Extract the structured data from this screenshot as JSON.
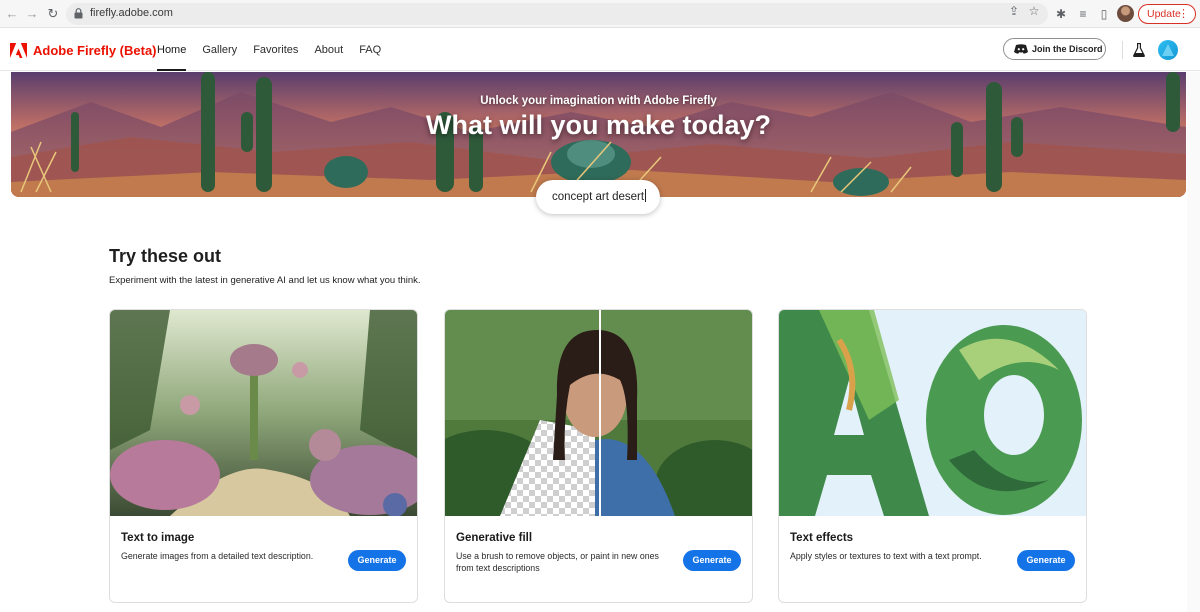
{
  "browser": {
    "url": "firefly.adobe.com",
    "update_label": "Update"
  },
  "header": {
    "brand": "Adobe Firefly (Beta)",
    "tabs": [
      {
        "label": "Home",
        "active": true
      },
      {
        "label": "Gallery",
        "active": false
      },
      {
        "label": "Favorites",
        "active": false
      },
      {
        "label": "About",
        "active": false
      },
      {
        "label": "FAQ",
        "active": false
      }
    ],
    "discord_label": "Join the Discord"
  },
  "hero": {
    "subtitle": "Unlock your imagination with Adobe Firefly",
    "title": "What will you make today?",
    "prompt_value": "concept art desert"
  },
  "section": {
    "title": "Try these out",
    "subtitle": "Experiment with the latest in generative AI and let us know what you think."
  },
  "cards": [
    {
      "title": "Text to image",
      "description": "Generate images from a detailed text description.",
      "button": "Generate"
    },
    {
      "title": "Generative fill",
      "description": "Use a brush to remove objects, or paint in new ones from text descriptions",
      "button": "Generate"
    },
    {
      "title": "Text effects",
      "description": "Apply styles or textures to text with a text prompt.",
      "button": "Generate"
    }
  ],
  "colors": {
    "brand_red": "#eb1000",
    "accent_blue": "#1473e6"
  }
}
